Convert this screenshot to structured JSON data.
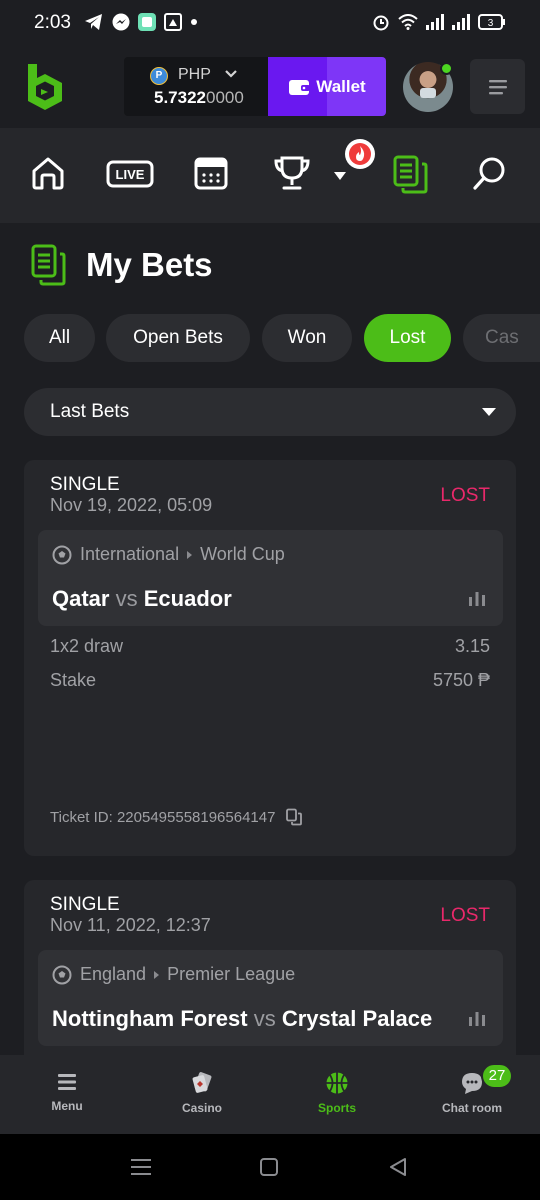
{
  "status_bar": {
    "time": "2:03",
    "battery": "3"
  },
  "header": {
    "currency": "PHP",
    "currency_symbol": "P",
    "balance_main": "5.7322",
    "balance_dim": "0000",
    "wallet_label": "Wallet"
  },
  "nav": {
    "live_label": "LIVE",
    "items": [
      "home-icon",
      "live-icon",
      "calendar-icon",
      "trophy-icon",
      "my-bets-icon",
      "search-icon"
    ]
  },
  "page": {
    "title": "My Bets"
  },
  "filters": {
    "all": "All",
    "open": "Open Bets",
    "won": "Won",
    "lost": "Lost",
    "cashout": "Cas",
    "active": "Lost"
  },
  "dropdown": {
    "label": "Last Bets"
  },
  "bets": [
    {
      "type": "SINGLE",
      "date": "Nov 19, 2022, 05:09",
      "status": "LOST",
      "league_region": "International",
      "league_name": "World Cup",
      "home": "Qatar",
      "vs": "vs",
      "away": "Ecuador",
      "market": "1x2 draw",
      "odds": "3.15",
      "stake_label": "Stake",
      "stake": "5750 ₱",
      "ticket": "Ticket ID: 2205495558196564147"
    },
    {
      "type": "SINGLE",
      "date": "Nov 11, 2022, 12:37",
      "status": "LOST",
      "league_region": "England",
      "league_name": "Premier League",
      "home": "Nottingham Forest",
      "vs": "vs",
      "away": "Crystal Palace"
    }
  ],
  "bottom_nav": {
    "menu": "Menu",
    "casino": "Casino",
    "sports": "Sports",
    "chat": "Chat room",
    "chat_badge": "27",
    "active": "Sports"
  },
  "colors": {
    "accent_green": "#4cbd18",
    "wallet_purple": "#6a18f0",
    "lost_red": "#e8286a",
    "bg": "#1d1e22"
  }
}
